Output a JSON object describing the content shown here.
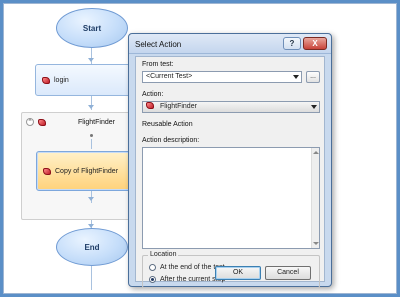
{
  "flow": {
    "start_label": "Start",
    "login_label": "login",
    "group_label": "FlightFinder",
    "copy_label": "Copy of FlightFinder",
    "end_label": "End"
  },
  "dialog": {
    "title": "Select Action",
    "help_label": "?",
    "close_label": "X",
    "from_test_label": "From test:",
    "from_test_value": "<Current Test>",
    "browse_label": "...",
    "action_label": "Action:",
    "action_value": "FlightFinder",
    "action_type": "Reusable Action",
    "description_label": "Action description:",
    "location_label": "Location",
    "location_options": [
      "At the end of the test",
      "After the current step"
    ],
    "location_selected": "After the current step",
    "ok_label": "OK",
    "cancel_label": "Cancel"
  },
  "colors": {
    "desktop": "#5b8fc7",
    "flow_node": "#c6defa",
    "selected_node": "#ffd27a",
    "dialog_frame": "#c8d9ee"
  },
  "icons": [
    "action-icon",
    "collapse-icon",
    "dropdown-arrow-icon",
    "help-icon",
    "close-icon"
  ]
}
